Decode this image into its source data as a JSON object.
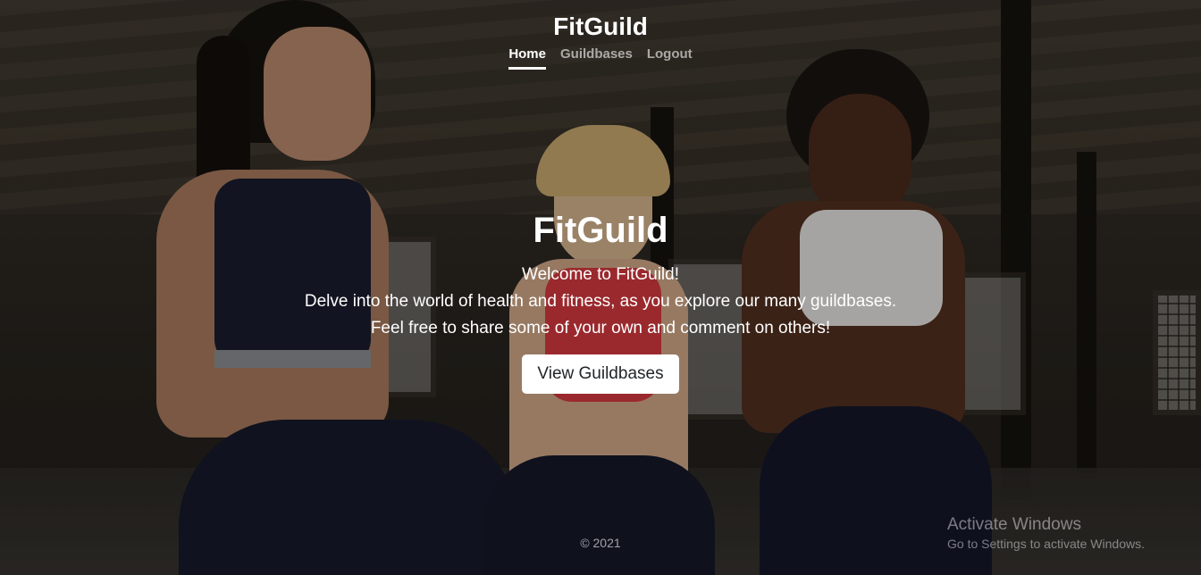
{
  "header": {
    "brand": "FitGuild",
    "nav": [
      {
        "label": "Home",
        "active": true
      },
      {
        "label": "Guildbases",
        "active": false
      },
      {
        "label": "Logout",
        "active": false
      }
    ]
  },
  "hero": {
    "title": "FitGuild",
    "lines": [
      "Welcome to FitGuild!",
      "Delve into the world of health and fitness, as you explore our many guildbases.",
      "Feel free to share some of your own and comment on others!"
    ],
    "button_label": "View Guildbases"
  },
  "footer": {
    "copyright": "© 2021"
  },
  "watermark": {
    "title": "Activate Windows",
    "subtitle": "Go to Settings to activate Windows."
  },
  "colors": {
    "button_bg": "#ffffff",
    "button_text": "#212529",
    "nav_active": "#ffffff",
    "nav_inactive": "rgba(255,255,255,0.6)"
  }
}
